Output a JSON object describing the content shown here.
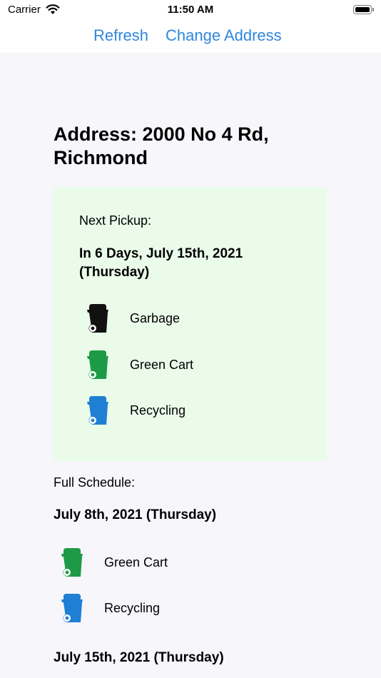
{
  "status": {
    "carrier": "Carrier",
    "time": "11:50 AM"
  },
  "nav": {
    "refresh_label": "Refresh",
    "change_address_label": "Change Address"
  },
  "address": "Address: 2000 No 4 Rd, Richmond",
  "next_pickup": {
    "label": "Next Pickup:",
    "date": "In 6 Days, July 15th, 2021 (Thursday)",
    "items": [
      {
        "label": "Garbage",
        "icon": "garbage-bin-icon",
        "color": "#111111"
      },
      {
        "label": "Green Cart",
        "icon": "green-cart-icon",
        "color": "#1d9a46"
      },
      {
        "label": "Recycling",
        "icon": "recycling-bin-icon",
        "color": "#1f7fd3"
      }
    ]
  },
  "full_schedule": {
    "label": "Full Schedule:",
    "days": [
      {
        "date": "July 8th, 2021 (Thursday)",
        "items": [
          {
            "label": "Green Cart",
            "icon": "green-cart-icon",
            "color": "#1d9a46"
          },
          {
            "label": "Recycling",
            "icon": "recycling-bin-icon",
            "color": "#1f7fd3"
          }
        ]
      },
      {
        "date": "July 15th, 2021 (Thursday)",
        "items": []
      }
    ]
  },
  "colors": {
    "accent": "#2f86dd",
    "card_background": "#eafbea",
    "page_background": "#f6f6fb"
  }
}
